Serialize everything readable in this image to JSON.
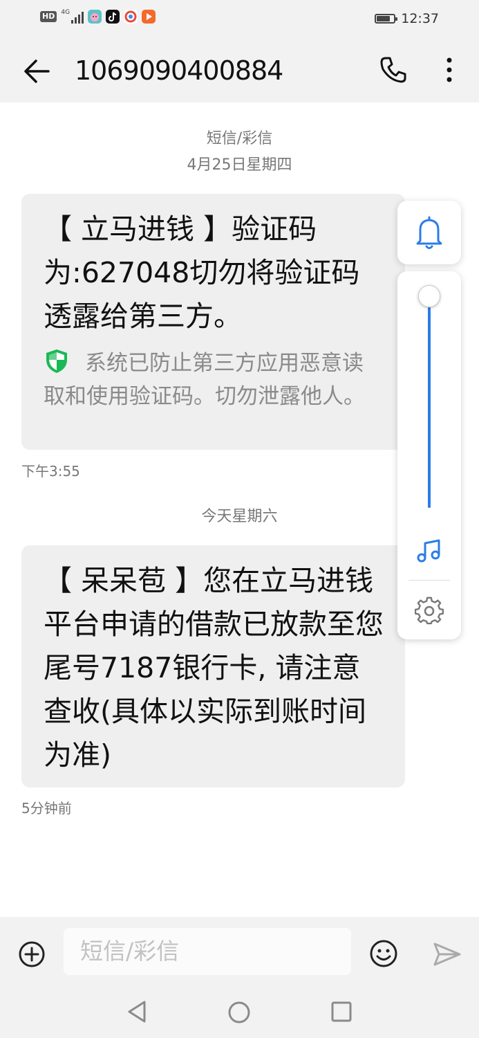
{
  "status_bar": {
    "hd_label": "HD",
    "network": "4G",
    "signal_level": 0.75,
    "battery_level": 0.8,
    "time": "12:37",
    "app_icons": [
      "app-icon-pig",
      "tiktok-icon",
      "browser-icon",
      "video-app-icon"
    ]
  },
  "header": {
    "title": "1069090400884"
  },
  "conversation": {
    "message_type": "短信/彩信",
    "date_separator_1": "4月25日星期四",
    "message_1": {
      "body": "【 立马进钱 】验证码为:627048切勿将验证码透露给第三方。",
      "security_note": "系统已防止第三方应用恶意读取和使用验证码。切勿泄露他人。",
      "time": "下午3:55"
    },
    "date_separator_2": "今天星期六",
    "message_2": {
      "body": "【 呆呆苞 】您在立马进钱平台申请的借款已放款至您尾号7187银行卡, 请注意查收(具体以实际到账时间为准)",
      "time": "5分钟前"
    }
  },
  "volume_panel": {
    "level": 0.0,
    "accent_color": "#2a7de6"
  },
  "composer": {
    "placeholder": "短信/彩信"
  },
  "colors": {
    "accent": "#2a7de6",
    "shield_green": "#19b955",
    "bubble": "#efefef"
  }
}
